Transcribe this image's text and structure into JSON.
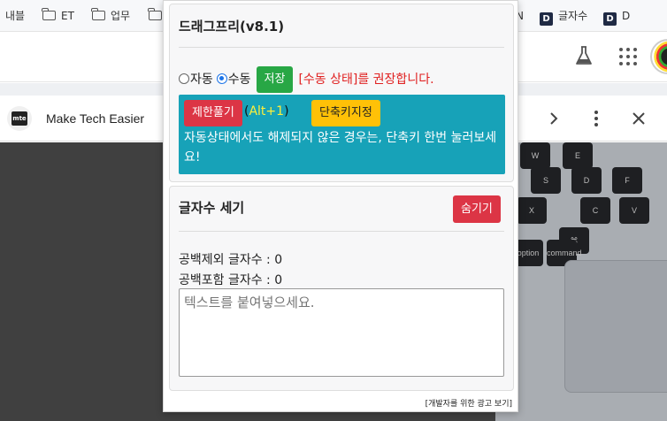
{
  "bookmarks": [
    {
      "label": "내블",
      "icon": "none"
    },
    {
      "label": "ET",
      "icon": "folder-icon"
    },
    {
      "label": "업무",
      "icon": "folder-icon"
    },
    {
      "label": "N",
      "icon": "none"
    },
    {
      "label": "글자수",
      "icon": "d-icon"
    },
    {
      "label": "D",
      "icon": "d-icon"
    }
  ],
  "d_icon_letter": "D",
  "site": {
    "logo_text": "mte",
    "title": "Make Tech Easier"
  },
  "keyboard": {
    "keys": [
      "W",
      "E",
      "S",
      "D",
      "F",
      "X",
      "C",
      "V",
      "⌘",
      "option",
      "command"
    ]
  },
  "popup": {
    "drag_free": {
      "title": "드래그프리(v8.1)",
      "mode_auto": "자동",
      "mode_manual": "수동",
      "selected_mode": "수동",
      "save_label": "저장",
      "recommend_text": "[수동 상태]를 권장합니다.",
      "unlock_label": "제한풀기",
      "shortcut_open": "(",
      "shortcut_key": "Alt+1",
      "shortcut_close": ")",
      "set_shortcut_label": "단축키지정",
      "info_text": "자동상태에서도 해제되지 않은 경우는, 단축키 한번 눌러보세요!"
    },
    "char_count": {
      "title": "글자수 세기",
      "hide_label": "숨기기",
      "no_space_label": "공백제외 글자수 : 0",
      "with_space_label": "공백포함 글자수 : 0",
      "placeholder": "텍스트를 붙여넣으세요."
    },
    "ad_link": "[개발자를 위한 광고 보기]"
  },
  "colors": {
    "save_button": "#28a745",
    "unlock_button": "#dc3545",
    "shortcut_button": "#ffc107",
    "info_box": "#17a2b8",
    "warning_text": "#e02020",
    "shortcut_key_text": "#ffef3a"
  }
}
